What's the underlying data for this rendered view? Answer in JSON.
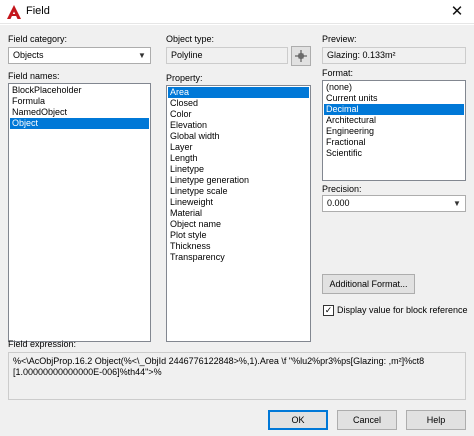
{
  "window": {
    "title": "Field",
    "close_glyph": "✕"
  },
  "field_category": {
    "label": "Field category:",
    "value": "Objects"
  },
  "field_names": {
    "label": "Field names:",
    "items": [
      "BlockPlaceholder",
      "Formula",
      "NamedObject",
      "Object"
    ],
    "selected": "Object"
  },
  "object_type": {
    "label": "Object type:",
    "value": "Polyline"
  },
  "property": {
    "label": "Property:",
    "items": [
      "Area",
      "Closed",
      "Color",
      "Elevation",
      "Global width",
      "Layer",
      "Length",
      "Linetype",
      "Linetype generation",
      "Linetype scale",
      "Lineweight",
      "Material",
      "Object name",
      "Plot style",
      "Thickness",
      "Transparency"
    ],
    "selected": "Area"
  },
  "preview": {
    "label": "Preview:",
    "value": "Glazing: 0.133m²"
  },
  "format": {
    "label": "Format:",
    "items": [
      "(none)",
      "Current units",
      "Decimal",
      "Architectural",
      "Engineering",
      "Fractional",
      "Scientific"
    ],
    "selected": "Decimal"
  },
  "precision": {
    "label": "Precision:",
    "value": "0.000"
  },
  "additional_format": {
    "label": "Additional Format..."
  },
  "display_block_ref": {
    "label": "Display value for block reference",
    "checked": true,
    "check_glyph": "✓"
  },
  "field_expression": {
    "label": "Field expression:",
    "lines": [
      "%<\\AcObjProp.16.2 Object(%<\\_ObjId 2446776122848>%,1).Area \\f \"%lu2%pr3%ps[Glazing: ,m²]%ct8",
      "[1.00000000000000E-006]%th44\">%"
    ]
  },
  "buttons": {
    "ok": "OK",
    "cancel": "Cancel",
    "help": "Help"
  },
  "icons": {
    "app": "autocad-logo-icon",
    "pick": "pick-object-icon",
    "dropdown": "chevron-down-icon"
  },
  "colors": {
    "selection": "#0078d7",
    "logo": "#c4161c",
    "panel": "#f0f0f0"
  }
}
